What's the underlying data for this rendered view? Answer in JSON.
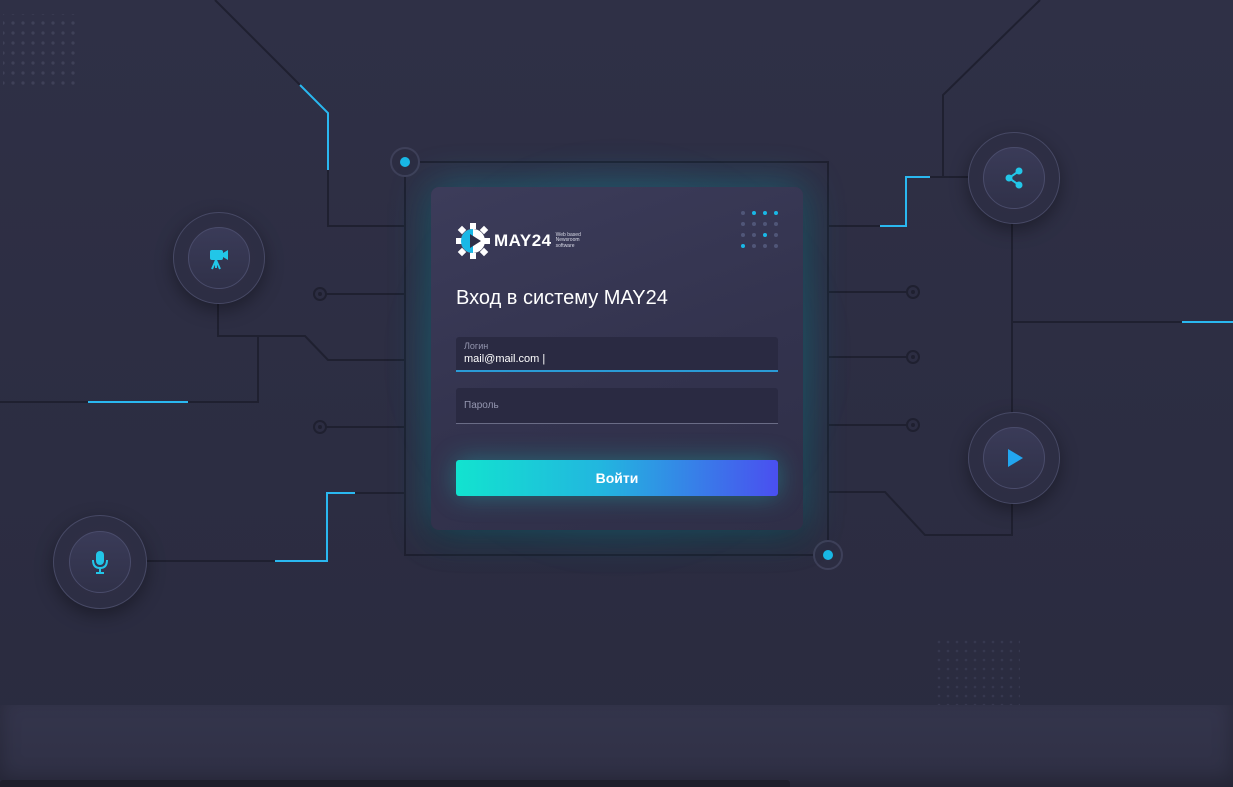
{
  "brand": {
    "name": "MAY24",
    "tagline_lines": [
      "Web based",
      "Newsroom",
      "software"
    ]
  },
  "login_form": {
    "title": "Вход в систему MAY24",
    "login_label": "Логин",
    "login_value": "mail@mail.com |",
    "password_label": "Пароль",
    "submit_label": "Войти"
  },
  "decor_icons": {
    "left_top": "video-camera-icon",
    "left_bottom": "microphone-icon",
    "right_top": "share-icon",
    "right_bottom": "play-icon"
  },
  "colors": {
    "background": "#2f3046",
    "accent_cyan": "#19b8e6",
    "button_start": "#12e3cf",
    "button_end": "#4a4ff0"
  }
}
